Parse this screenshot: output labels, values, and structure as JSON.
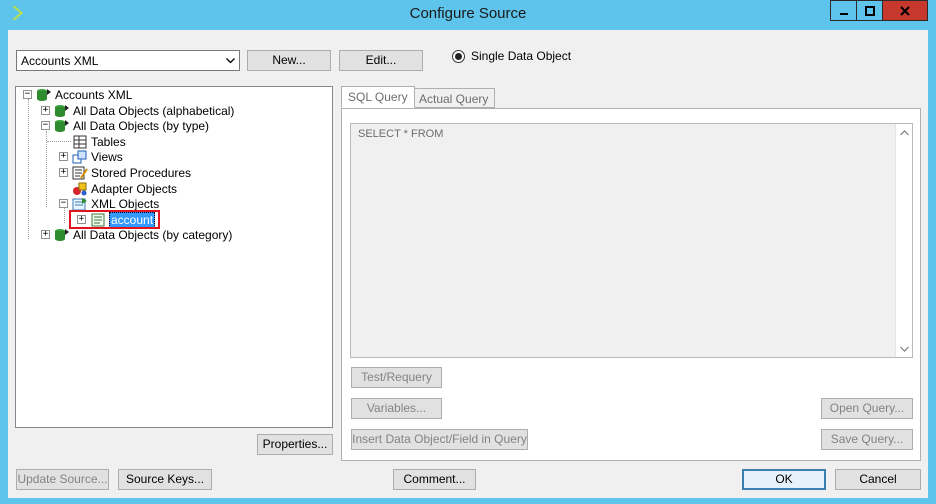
{
  "window": {
    "title": "Configure Source"
  },
  "toolbar": {
    "source_value": "Accounts XML",
    "new_label": "New...",
    "edit_label": "Edit...",
    "single_data_object_label": "Single Data Object"
  },
  "tree": {
    "root": "Accounts XML",
    "alphabetical": "All Data Objects (alphabetical)",
    "by_type": "All Data Objects (by type)",
    "tables": "Tables",
    "views": "Views",
    "stored_procedures": "Stored Procedures",
    "adapter_objects": "Adapter Objects",
    "xml_objects": "XML Objects",
    "account": "account",
    "by_category": "All Data Objects (by category)"
  },
  "tabs": {
    "sql_query": "SQL Query",
    "actual_query": "Actual Query"
  },
  "query": {
    "text": "SELECT * FROM"
  },
  "buttons": {
    "properties": "Properties...",
    "test_requery": "Test/Requery",
    "variables": "Variables...",
    "insert": "Insert Data Object/Field in Query",
    "open_query": "Open Query...",
    "save_query": "Save Query...",
    "update_source": "Update Source...",
    "source_keys": "Source Keys...",
    "comment": "Comment...",
    "ok": "OK",
    "cancel": "Cancel"
  }
}
